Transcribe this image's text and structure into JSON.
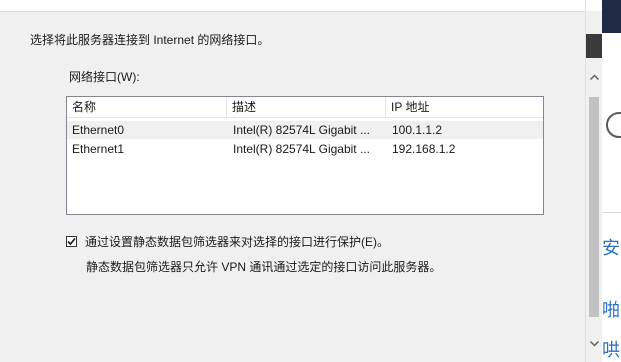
{
  "dialog": {
    "intro_text": "选择将此服务器连接到 Internet 的网络接口。",
    "interfaces_label": "网络接口(W):"
  },
  "interfaces_list": {
    "columns": [
      "名称",
      "描述",
      "IP 地址"
    ],
    "rows": [
      {
        "name": "Ethernet0",
        "description": "Intel(R) 82574L Gigabit ...",
        "ip": "100.1.1.2",
        "selected_highlight": true
      },
      {
        "name": "Ethernet1",
        "description": "Intel(R) 82574L Gigabit ...",
        "ip": "192.168.1.2",
        "selected_highlight": false
      }
    ]
  },
  "protection": {
    "checked": true,
    "label": "通过设置静态数据包筛选器来对选择的接口进行保护(E)。",
    "note": "静态数据包筛选器只允许 VPN 通讯通过选定的接口访问此服务器。"
  },
  "scrollbar": {
    "up_icon": "chevron-up-icon",
    "down_icon": "chevron-down-icon"
  },
  "background_window": {
    "partial_chars": [
      "安",
      "啪",
      "哄"
    ],
    "circle_icon": "circle-icon"
  }
}
